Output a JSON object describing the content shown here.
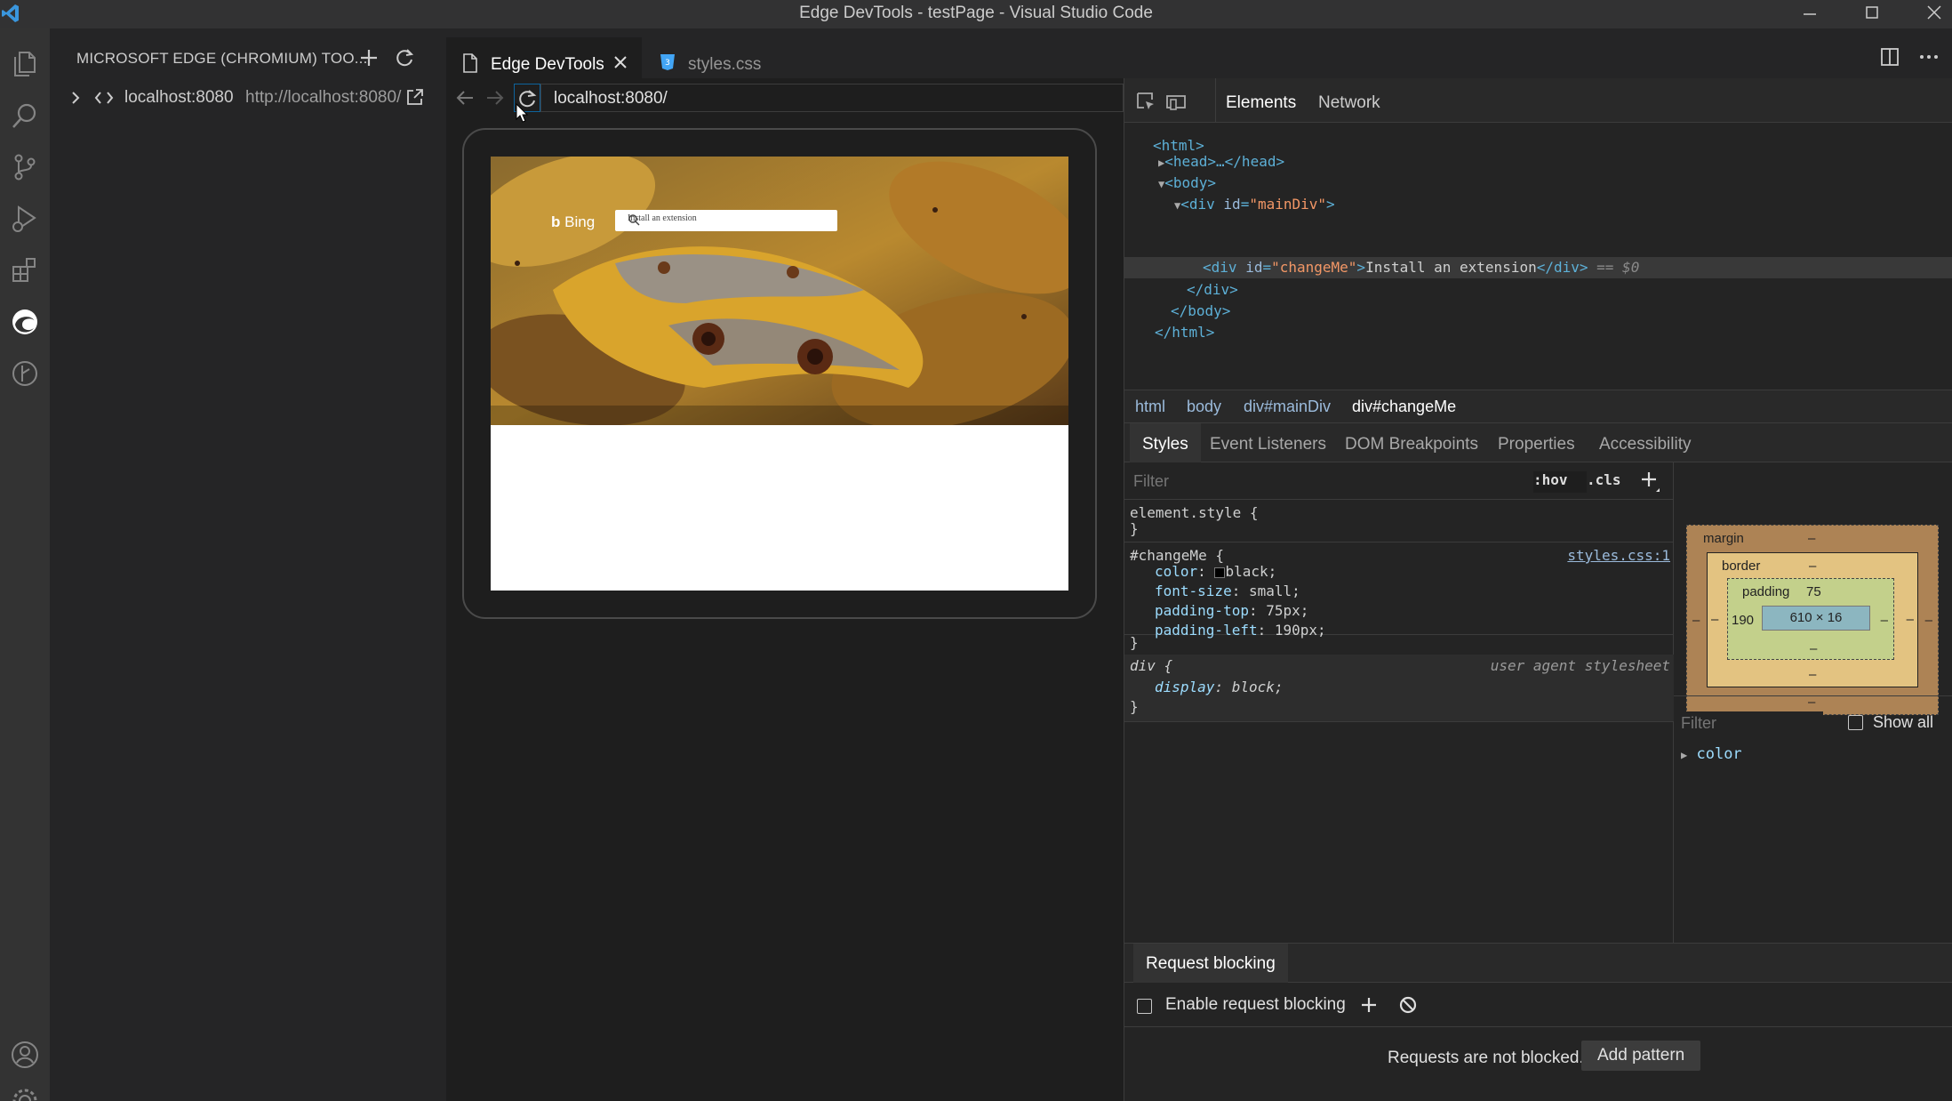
{
  "window": {
    "title": "Edge DevTools - testPage - Visual Studio Code"
  },
  "sidebar": {
    "header": "MICROSOFT EDGE (CHROMIUM) TOO...",
    "target": {
      "name": "localhost:8080",
      "url": "http://localhost:8080/"
    }
  },
  "tabs": [
    {
      "label": "Edge DevTools",
      "active": true
    },
    {
      "label": "styles.css",
      "active": false
    }
  ],
  "screencast": {
    "url": "localhost:8080/",
    "page": {
      "logo_text": "Bing",
      "search_text": "Install an extension"
    }
  },
  "devtools": {
    "tabs": [
      "Elements",
      "Network"
    ],
    "dom": {
      "html_open": "<html>",
      "head": "<head>…</head>",
      "body_open": "<body>",
      "maindiv_tag": "div",
      "maindiv_attr": "id",
      "maindiv_val": "\"mainDiv\"",
      "sel_tag": "div",
      "sel_attr": "id",
      "sel_val": "\"changeMe\"",
      "sel_text": "Install an extension",
      "sel_close": "</div>",
      "sel_marker": "== $0",
      "div_close": "</div>",
      "body_close": "</body>",
      "html_close": "</html>"
    },
    "breadcrumbs": [
      "html",
      "body",
      "div#mainDiv",
      "div#changeMe"
    ],
    "subtabs": [
      "Styles",
      "Event Listeners",
      "DOM Breakpoints",
      "Properties",
      "Accessibility"
    ],
    "styles": {
      "filter_placeholder": "Filter",
      "hov": ":hov",
      "cls": ".cls",
      "element_style": "element.style {",
      "close_brace": "}",
      "rule1": {
        "selector": "#changeMe {",
        "source": "styles.css:1",
        "props": [
          {
            "name": "color",
            "value": "black;"
          },
          {
            "name": "font-size",
            "value": "small;"
          },
          {
            "name": "padding-top",
            "value": "75px;"
          },
          {
            "name": "padding-left",
            "value": "190px;"
          }
        ]
      },
      "rule2": {
        "selector": "div {",
        "source": "user agent stylesheet",
        "props": [
          {
            "name": "display",
            "value": "block;"
          }
        ]
      }
    },
    "boxmodel": {
      "margin_label": "margin",
      "margin_top": "–",
      "margin_bottom": "–",
      "margin_left": "–",
      "margin_right": "–",
      "border_label": "border",
      "border_top": "–",
      "border_bottom": "–",
      "border_left": "–",
      "border_right": "–",
      "padding_label": "padding",
      "padding_top": "75",
      "padding_bottom": "–",
      "padding_left": "190",
      "padding_right": "–",
      "content": "610 × 16",
      "filter_placeholder": "Filter",
      "show_all": "Show all",
      "computed_first": "color"
    },
    "drawer": {
      "tab": "Request blocking",
      "enable_label": "Enable request blocking",
      "status": "Requests are not blocked.",
      "add_pattern": "Add pattern"
    }
  },
  "colors": {
    "accent": "#0e639c",
    "background": "#1e1e1e",
    "activity_bar": "#333333"
  }
}
